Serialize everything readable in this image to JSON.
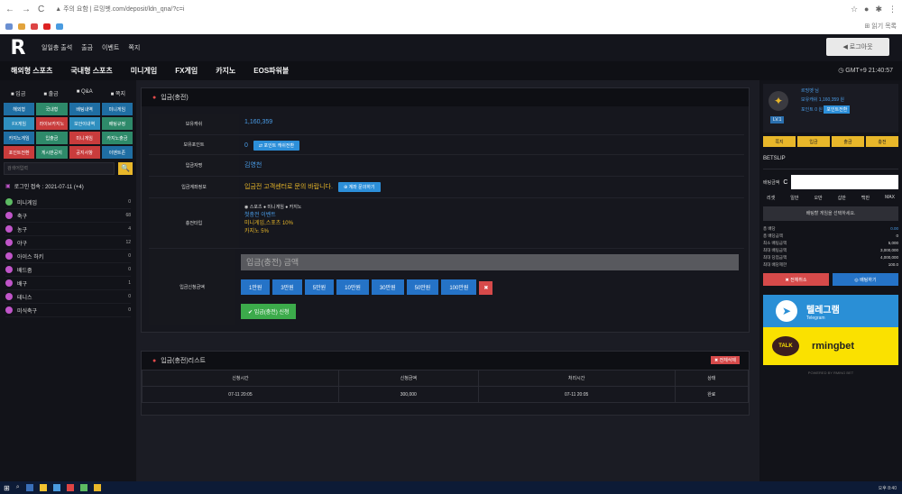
{
  "browser": {
    "back": "←",
    "forward": "→",
    "reload": "C",
    "url": "▲ 주의 요함 | 르밍벳.com/deposit/ldn_qna/?c=i",
    "bookmarks_label": "⊞ 읽기 목록"
  },
  "site": {
    "logo": "R",
    "top_links": [
      "일일충 출석",
      "출금",
      "이벤트",
      "쪽지"
    ],
    "logout": "◀ 로그아웃",
    "nav": [
      "해외형 스포츠",
      "국내형 스포츠",
      "미니게임",
      "FX게임",
      "카지노",
      "EOS파워볼"
    ],
    "clock": "◷ GMT+9 21:40:57"
  },
  "left": {
    "tabs": [
      "입금",
      "출금",
      "Q&A",
      "쪽지"
    ],
    "grid": [
      {
        "label": "해외형",
        "color": "#1f6ea3"
      },
      {
        "label": "국내형",
        "color": "#2e8a6a"
      },
      {
        "label": "배팅내역",
        "color": "#1f6ea3"
      },
      {
        "label": "미니게임",
        "color": "#1f6ea3"
      },
      {
        "label": "FX게임",
        "color": "#2f8fbf"
      },
      {
        "label": "라이브카지노",
        "color": "#c93c3c"
      },
      {
        "label": "보안이내역",
        "color": "#2f8fbf"
      },
      {
        "label": "배팅규정",
        "color": "#2e8a6a"
      },
      {
        "label": "카지노게임",
        "color": "#1f6ea3"
      },
      {
        "label": "입출금",
        "color": "#2e8a6a"
      },
      {
        "label": "미니게임",
        "color": "#c93c3c"
      },
      {
        "label": "카지노출금",
        "color": "#2e8a6a"
      },
      {
        "label": "포인트전환",
        "color": "#c93c3c"
      },
      {
        "label": "게시판공지",
        "color": "#2e8a6a"
      },
      {
        "label": "공지사항",
        "color": "#c93c3c"
      },
      {
        "label": "이벤트존",
        "color": "#1f6ea3"
      }
    ],
    "search_placeholder": "검색어입력",
    "search_btn": "🔍",
    "login_info": "로그인 접속 : 2021-07-11 (+4)",
    "sports": [
      {
        "name": "미니게임",
        "count": "0",
        "color": "#5dbb63"
      },
      {
        "name": "축구",
        "count": "68",
        "color": "#c055c9"
      },
      {
        "name": "농구",
        "count": "4",
        "color": "#c055c9"
      },
      {
        "name": "야구",
        "count": "12",
        "color": "#c055c9"
      },
      {
        "name": "아이스 하키",
        "count": "0",
        "color": "#c055c9"
      },
      {
        "name": "배드줌",
        "count": "0",
        "color": "#c055c9"
      },
      {
        "name": "배구",
        "count": "1",
        "color": "#c055c9"
      },
      {
        "name": "테니스",
        "count": "0",
        "color": "#c055c9"
      },
      {
        "name": "미식축구",
        "count": "0",
        "color": "#c055c9"
      }
    ]
  },
  "deposit": {
    "title": "입금(충전)",
    "fields": {
      "balance_label": "보유캐쉬",
      "balance": "1,160,359",
      "points_label": "보유포인트",
      "points": "0",
      "points_btn": "⇄ 포인트 캐쉬전환",
      "depositor_label": "입금자명",
      "depositor": "김영천",
      "account_label": "입금계좌정보",
      "account_text": "입금전 고객센터로 문의 바랍니다.",
      "account_btn": "⊕ 계좌 문의하기",
      "bonus_label": "충전타입",
      "bonus_options": [
        "스포츠",
        "미니게임",
        "카지노"
      ],
      "bonus_line1": "첫충전 이벤트",
      "bonus_line2": "미니게임,스포츠 10%",
      "bonus_line3": "카지노 5%",
      "amount_label": "입금신청금액",
      "amount_placeholder": "입금(충전) 금액",
      "amount_buttons": [
        "1만원",
        "3만원",
        "5만원",
        "10만원",
        "30만원",
        "50만원",
        "100만원"
      ],
      "amount_clear": "✖",
      "submit": "✔ 입금(충전) 신청"
    }
  },
  "history": {
    "title": "입금(충전)리스트",
    "delete_btn": "✖ 전체삭제",
    "headers": [
      "신청시간",
      "신청금액",
      "처리시간",
      "상태"
    ],
    "rows": [
      [
        "07-11 20:05",
        "300,000",
        "07-11 20:05",
        "완료"
      ]
    ]
  },
  "right": {
    "user_lines": [
      "르밍벳 님",
      "보유캐쉬 1,160,359 원",
      "포인트 0 원"
    ],
    "level": "LV.1",
    "point_btn": "포인트전환",
    "quick": [
      "쪽지",
      "입금",
      "출금",
      "충전"
    ],
    "betslip_title": "BETSLIP",
    "bet_amount_label": "배팅금액",
    "reset": "C",
    "chips": [
      "리셋",
      "일만",
      "오만",
      "십만",
      "백만",
      "MAX"
    ],
    "slip_msg": "배팅할 게임을 선택하세요.",
    "kv": [
      [
        "총 배당",
        "0.00"
      ],
      [
        "총 배당금액",
        "0"
      ],
      [
        "최소 배팅금액",
        "5,000"
      ],
      [
        "최대 배팅금액",
        "3,000,000"
      ],
      [
        "최대 당첨금액",
        "4,000,000"
      ],
      [
        "최대 배당제한",
        "100.0"
      ]
    ],
    "btn_clear": "✖ 전체취소",
    "btn_bet": "◎ 배팅하기",
    "telegram_title": "텔레그램",
    "telegram_sub": "Telegram",
    "talk_label": "TALK",
    "talk_id": "rmingbet",
    "powered": "POWERED BY RMING BET"
  },
  "taskbar": {
    "tray": "오후 8:40"
  },
  "colors": {
    "accent_blue": "#2c8fd9",
    "accent_yellow": "#e8b72a",
    "accent_red": "#d64a4a",
    "accent_green": "#3cab4b",
    "bg": "#1b1c24"
  }
}
